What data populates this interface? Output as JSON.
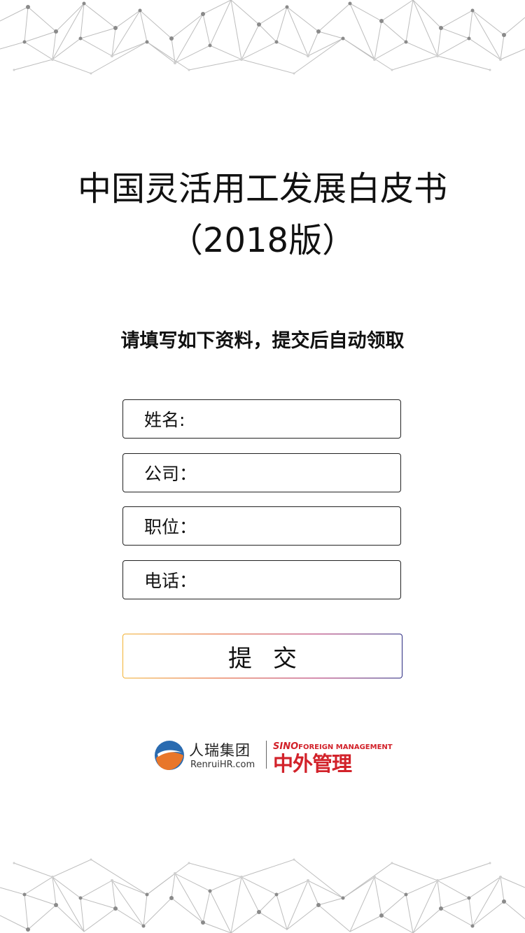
{
  "header": {
    "title_line1": "中国灵活用工发展白皮书",
    "title_line2": "（2018版）"
  },
  "instruction": "请填写如下资料，提交后自动领取",
  "form": {
    "fields": [
      {
        "label": "姓名:",
        "value": ""
      },
      {
        "label": "公司：",
        "value": ""
      },
      {
        "label": "职位：",
        "value": ""
      },
      {
        "label": "电话：",
        "value": ""
      }
    ],
    "submit_label": "提交"
  },
  "footer": {
    "renrui_name": "人瑞集团",
    "renrui_url": "RenruiHR.com",
    "sino_en_prefix": "SINO",
    "sino_en_suffix": "FOREIGN MANAGEMENT",
    "sino_cn": "中外管理"
  },
  "colors": {
    "brand_red": "#d2222a",
    "renrui_blue": "#2a6bb0",
    "renrui_orange": "#e8762a",
    "submit_gradient_start": "#f2b233",
    "submit_gradient_end": "#2a2a80"
  },
  "icons": {
    "renrui_logo": "renrui-logo-icon"
  }
}
